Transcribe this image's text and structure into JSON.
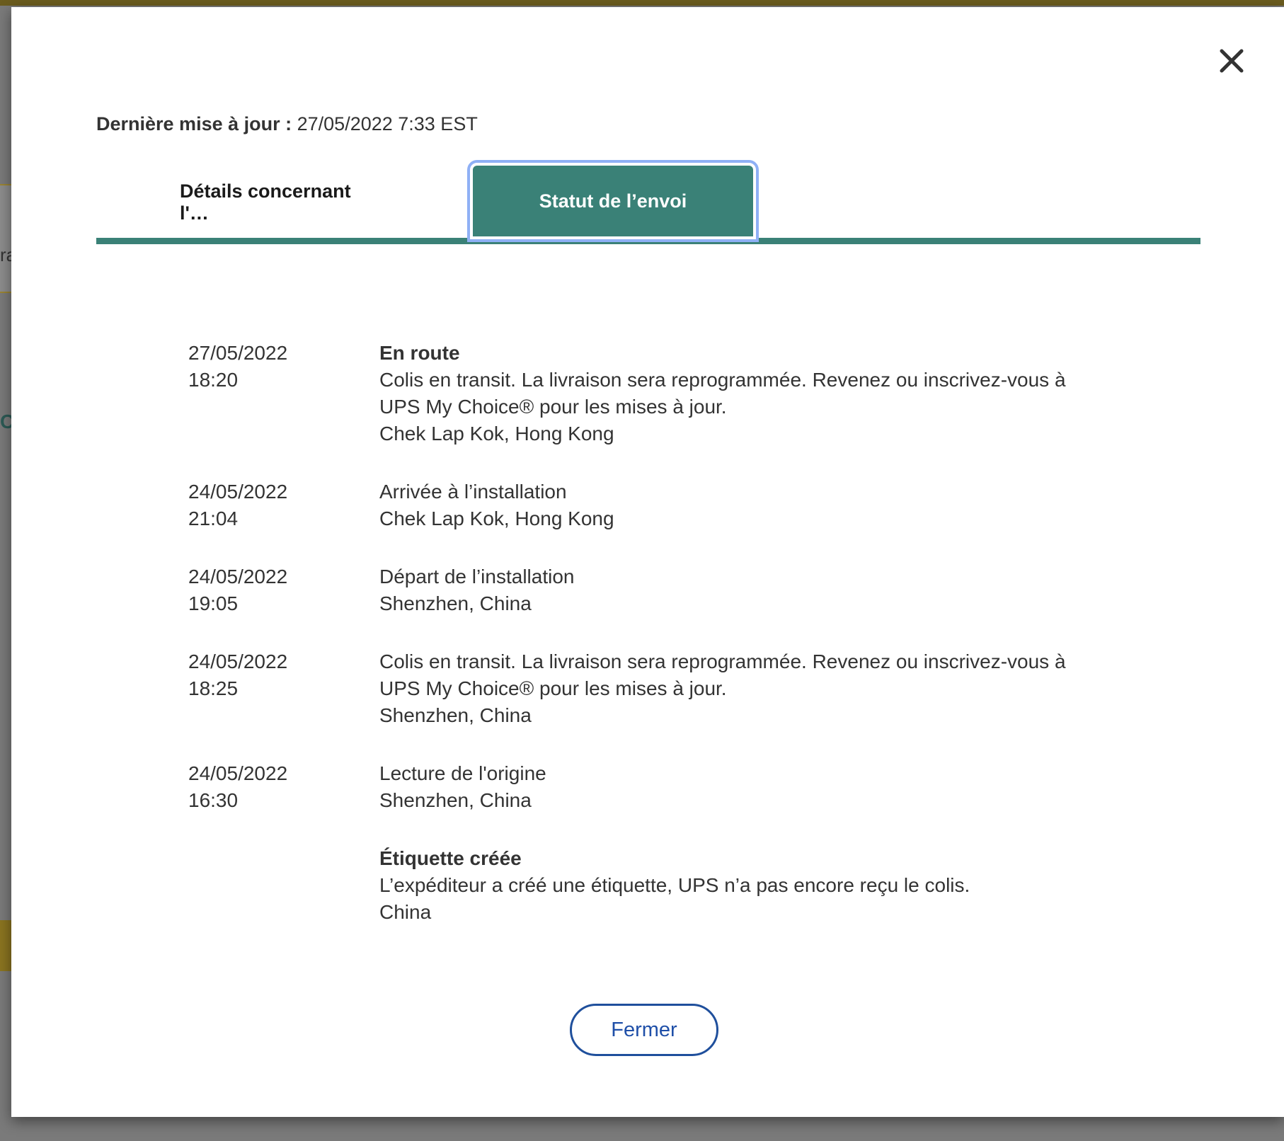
{
  "backdrop": {
    "partial_text_1": "ra",
    "partial_text_2": "C"
  },
  "modal": {
    "last_update_label": "Dernière mise à jour :",
    "last_update_value": "27/05/2022 7:33 EST",
    "tabs": [
      {
        "label": "Détails concernant l'…",
        "active": false
      },
      {
        "label": "Statut de l’envoi",
        "active": true
      }
    ],
    "close_icon": "close-icon",
    "events": [
      {
        "date": "27/05/2022",
        "time": "18:20",
        "status": "En route",
        "description": "Colis en transit. La livraison sera reprogrammée. Revenez ou inscrivez-vous à UPS My Choice® pour les mises à jour.",
        "location": "Chek Lap Kok, Hong Kong"
      },
      {
        "date": "24/05/2022",
        "time": "21:04",
        "status": "",
        "description": "Arrivée à l’installation",
        "location": "Chek Lap Kok, Hong Kong"
      },
      {
        "date": "24/05/2022",
        "time": "19:05",
        "status": "",
        "description": "Départ de l’installation",
        "location": "Shenzhen, China"
      },
      {
        "date": "24/05/2022",
        "time": "18:25",
        "status": "",
        "description": "Colis en transit. La livraison sera reprogrammée. Revenez ou inscrivez-vous à UPS My Choice® pour les mises à jour.",
        "location": "Shenzhen, China"
      },
      {
        "date": "24/05/2022",
        "time": "16:30",
        "status": "",
        "description": "Lecture de l'origine",
        "location": "Shenzhen, China"
      },
      {
        "date": "",
        "time": "",
        "status": "Étiquette créée",
        "description": "L’expéditeur a créé une étiquette, UPS n’a pas encore reçu le colis.",
        "location": "China"
      }
    ],
    "close_button_label": "Fermer"
  },
  "colors": {
    "accent": "#3a8177",
    "button_border": "#1f4f9c",
    "focus_ring": "#8fb0f5"
  }
}
